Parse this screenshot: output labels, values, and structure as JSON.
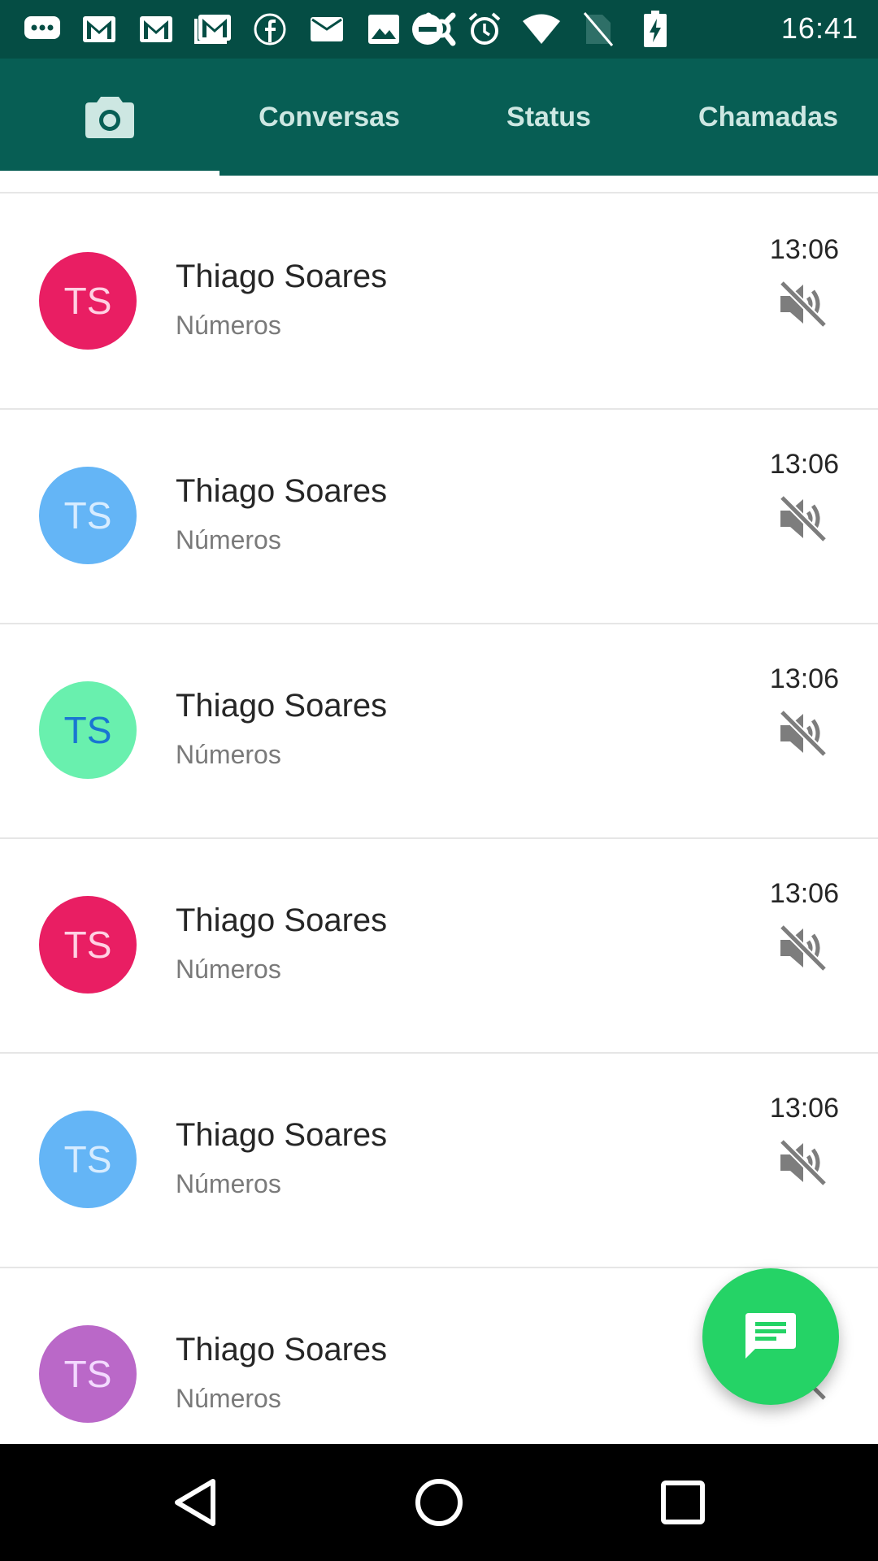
{
  "status_bar": {
    "time": "16:41",
    "left_icons": [
      "chat-bubble-icon",
      "gmail-icon",
      "gmail-icon",
      "gmail-icon",
      "facebook-icon",
      "mail-icon",
      "image-icon",
      "app-icon"
    ],
    "right_icons": [
      "do-not-disturb-icon",
      "alarm-icon",
      "wifi-icon",
      "no-sim-icon",
      "battery-charging-icon"
    ]
  },
  "tabs": {
    "camera_icon": "camera-icon",
    "conversas": "Conversas",
    "status": "Status",
    "chamadas": "Chamadas",
    "active": "camera"
  },
  "chats": [
    {
      "initials": "TS",
      "name": "Thiago Soares",
      "subtitle": "Números",
      "time": "13:06",
      "muted": true,
      "avatar_color": "#e91e63",
      "initials_color": "#ffd1e3"
    },
    {
      "initials": "TS",
      "name": "Thiago Soares",
      "subtitle": "Números",
      "time": "13:06",
      "muted": true,
      "avatar_color": "#64b5f6",
      "initials_color": "#d7ecff"
    },
    {
      "initials": "TS",
      "name": "Thiago Soares",
      "subtitle": "Números",
      "time": "13:06",
      "muted": true,
      "avatar_color": "#69f0ae",
      "initials_color": "#1976d2"
    },
    {
      "initials": "TS",
      "name": "Thiago Soares",
      "subtitle": "Números",
      "time": "13:06",
      "muted": true,
      "avatar_color": "#e91e63",
      "initials_color": "#ffd1e3"
    },
    {
      "initials": "TS",
      "name": "Thiago Soares",
      "subtitle": "Números",
      "time": "13:06",
      "muted": true,
      "avatar_color": "#64b5f6",
      "initials_color": "#d7ecff"
    },
    {
      "initials": "TS",
      "name": "Thiago Soares",
      "subtitle": "Números",
      "time": "",
      "muted": true,
      "avatar_color": "#ba68c8",
      "initials_color": "#f3d9ff"
    }
  ],
  "fab": {
    "icon": "new-chat-icon",
    "color": "#25d366"
  },
  "nav": {
    "back": "back-icon",
    "home": "home-icon",
    "recents": "recents-icon"
  },
  "colors": {
    "status_bar": "#054d44",
    "app_bar": "#075e54",
    "tab_text": "#cde7e2"
  }
}
